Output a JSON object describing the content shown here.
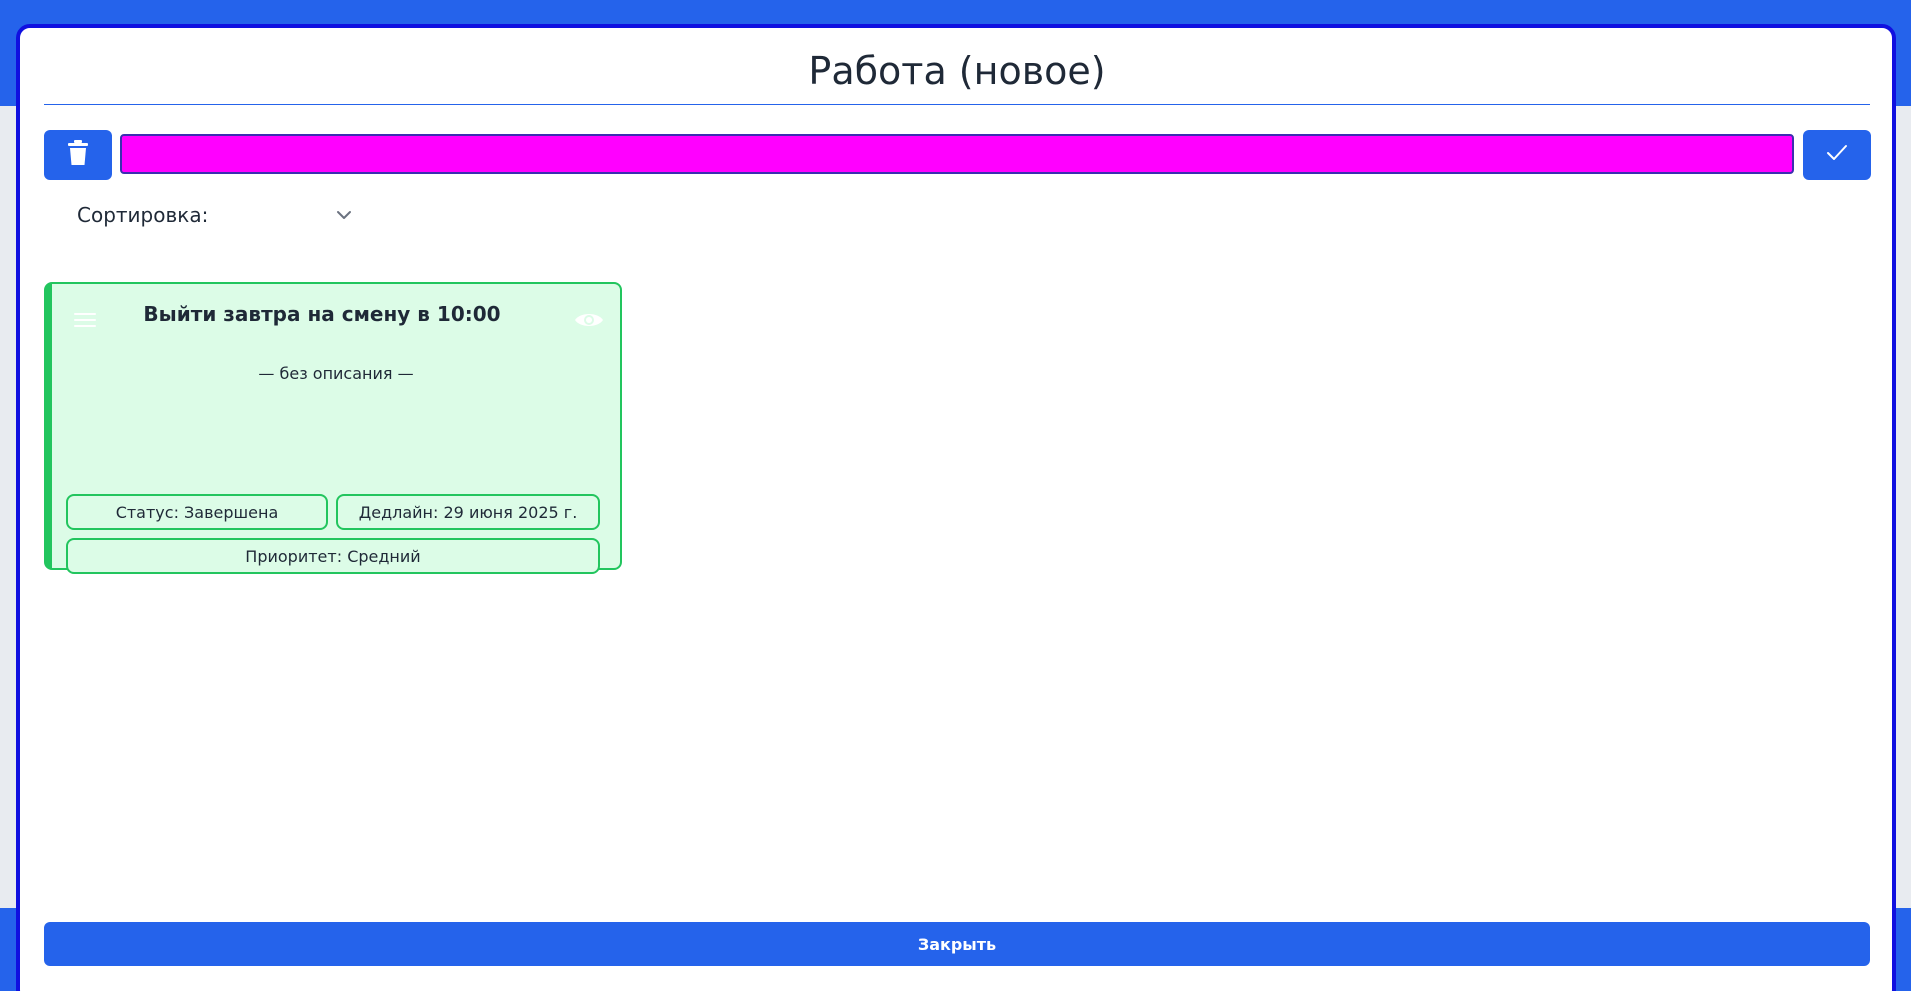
{
  "modal": {
    "title": "Работа (новое)",
    "close_label": "Закрыть"
  },
  "toolbar": {
    "delete_icon": "trash-icon",
    "confirm_icon": "check-icon",
    "color_value": "#ff00ff"
  },
  "sort": {
    "label": "Сортировка:",
    "selected": ""
  },
  "task": {
    "title": "Выйти завтра на смену в 10:00",
    "description": "— без описания —",
    "status": "Статус: Завершена",
    "deadline": "Дедлайн: 29 июня 2025 г.",
    "priority": "Приоритет: Средний",
    "accent_color": "#22c55e"
  },
  "colors": {
    "primary": "#2563eb",
    "success": "#22c55e",
    "success_bg": "#dcfce7"
  }
}
